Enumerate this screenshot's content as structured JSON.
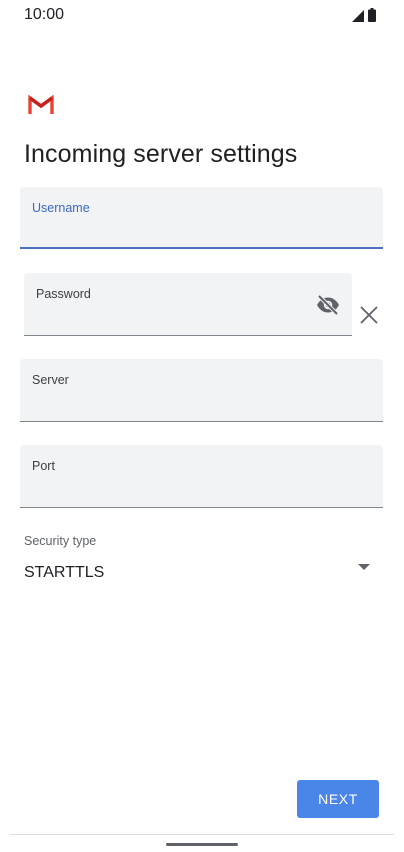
{
  "status_bar": {
    "time": "10:00"
  },
  "header": {
    "logo": "gmail-logo",
    "title": "Incoming server settings"
  },
  "form": {
    "username": {
      "label": "Username",
      "value": "",
      "focused": true
    },
    "password": {
      "label": "Password",
      "value": "",
      "visibility_icon": "eye-off-icon",
      "clear_icon": "close-icon"
    },
    "server": {
      "label": "Server",
      "value": ""
    },
    "port": {
      "label": "Port",
      "value": ""
    },
    "security_type": {
      "label": "Security type",
      "selected": "STARTTLS",
      "icon": "dropdown-arrow-icon"
    }
  },
  "actions": {
    "next_label": "NEXT"
  },
  "colors": {
    "accent": "#4a85e8",
    "focus": "#3c68c6",
    "field_bg": "#f1f3f4",
    "gmail_red": "#ea4335"
  }
}
